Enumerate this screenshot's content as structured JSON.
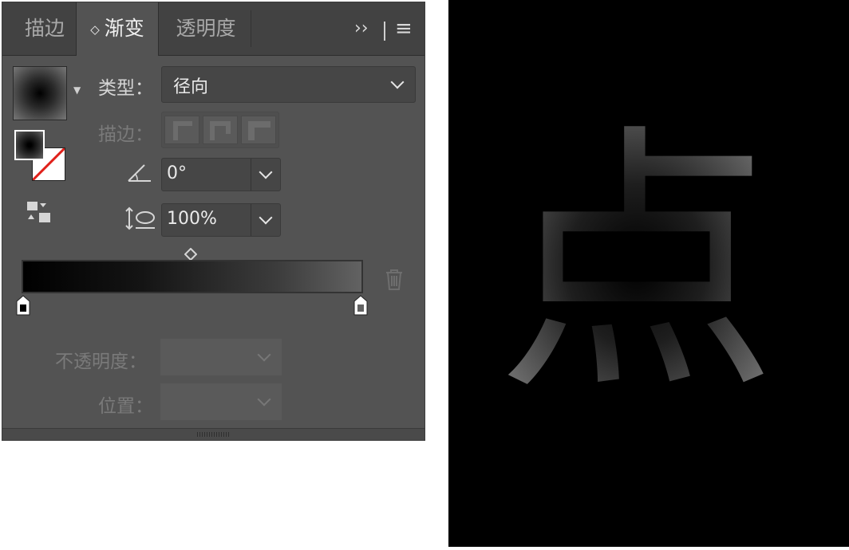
{
  "tabs": [
    {
      "label": "描边",
      "active": false
    },
    {
      "label": "渐变",
      "active": true
    },
    {
      "label": "透明度",
      "active": false
    }
  ],
  "toolbar": {
    "expand_icon": "››",
    "menu_icon": "≡"
  },
  "gradient": {
    "type_label": "类型：",
    "type_value": "径向",
    "stroke_label": "描边：",
    "angle_value": "0°",
    "aspect_value": "100%",
    "opacity_label": "不透明度：",
    "location_label": "位置：",
    "stops_colors": [
      "#000000",
      "#626262"
    ]
  },
  "canvas": {
    "character": "点"
  },
  "colors": {
    "panel_bg": "#535353",
    "tabbar_bg": "#424242",
    "accent_red": "#e0201a"
  }
}
